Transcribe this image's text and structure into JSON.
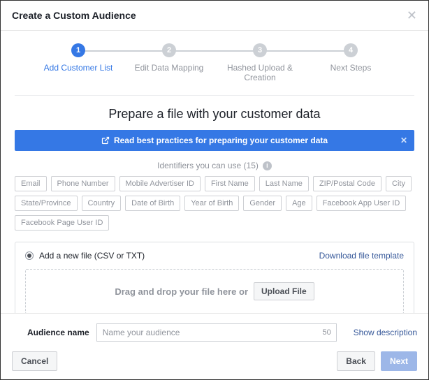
{
  "header": {
    "title": "Create a Custom Audience"
  },
  "stepper": {
    "steps": [
      {
        "num": "1",
        "label": "Add Customer List",
        "active": true
      },
      {
        "num": "2",
        "label": "Edit Data Mapping",
        "active": false
      },
      {
        "num": "3",
        "label": "Hashed Upload & Creation",
        "active": false
      },
      {
        "num": "4",
        "label": "Next Steps",
        "active": false
      }
    ]
  },
  "main": {
    "heading": "Prepare a file with your customer data",
    "banner_text": "Read best practices for preparing your customer data",
    "identifiers_label": "Identifiers you can use (15)",
    "identifiers": [
      "Email",
      "Phone Number",
      "Mobile Advertiser ID",
      "First Name",
      "Last Name",
      "ZIP/Postal Code",
      "City",
      "State/Province",
      "Country",
      "Date of Birth",
      "Year of Birth",
      "Gender",
      "Age",
      "Facebook App User ID",
      "Facebook Page User ID"
    ],
    "add_file_label": "Add a new file (CSV or TXT)",
    "download_template_label": "Download file template",
    "dropzone_text": "Drag and drop your file here or",
    "upload_button": "Upload File"
  },
  "footer": {
    "audience_name_label": "Audience name",
    "audience_name_placeholder": "Name your audience",
    "audience_name_count": "50",
    "show_description_label": "Show description",
    "cancel": "Cancel",
    "back": "Back",
    "next": "Next"
  }
}
